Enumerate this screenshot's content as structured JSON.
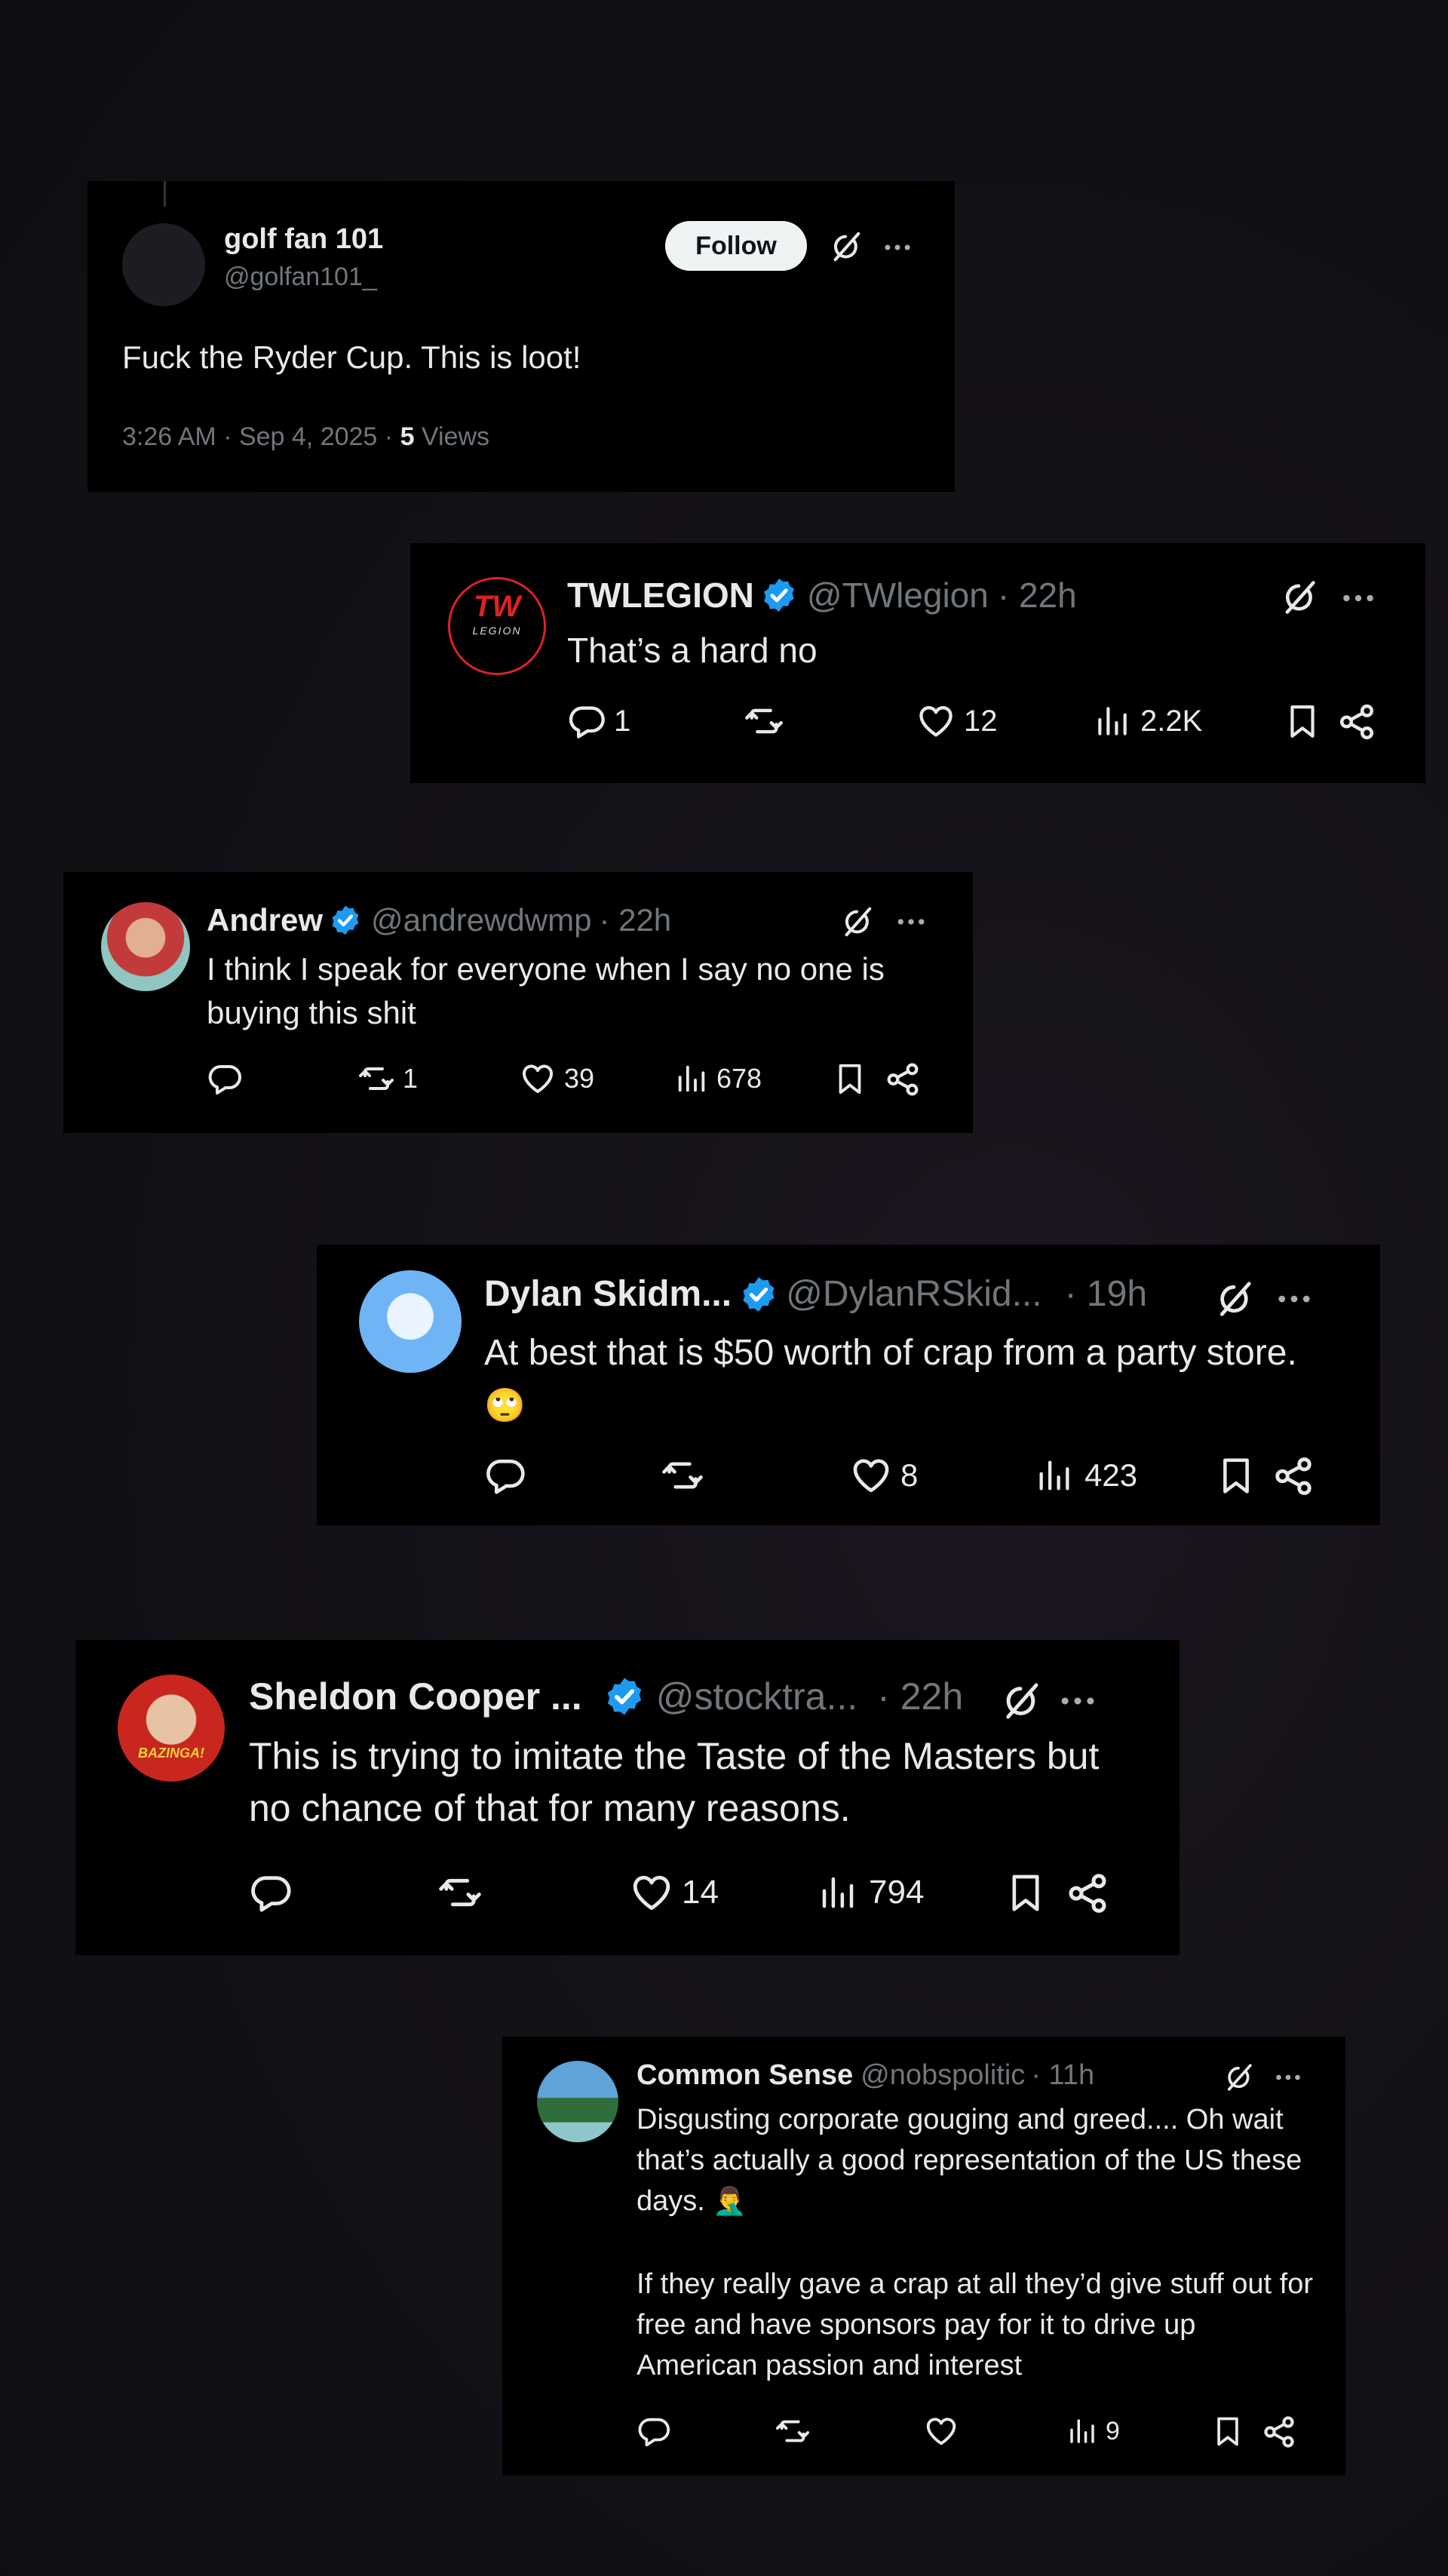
{
  "main_post": {
    "name": "golf fan 101",
    "handle": "@golfan101_",
    "follow_label": "Follow",
    "text": "Fuck the Ryder Cup. This is loot!",
    "timestamp": "3:26 AM · Sep 4, 2025 · ",
    "views_count": "5",
    "views_label": " Views"
  },
  "replies": [
    {
      "name": "TWLEGION",
      "handle": "@TWlegion",
      "time": "· 22h",
      "text": "That’s a hard no",
      "replies": "1",
      "reposts": "",
      "likes": "12",
      "views": "2.2K",
      "avatar_text": "TW",
      "avatar_sub": "LEGION"
    },
    {
      "name": "Andrew",
      "handle": "@andrewdwmp",
      "time": "· 22h",
      "text": "I think I speak for everyone when I say no one is buying this shit",
      "replies": "",
      "reposts": "1",
      "likes": "39",
      "views": "678"
    },
    {
      "name": "Dylan Skidm...",
      "handle": "@DylanRSkid...",
      "time": "· 19h",
      "text": "At best that is $50 worth of crap from a party store.",
      "emoji": "🙄",
      "replies": "",
      "reposts": "",
      "likes": "8",
      "views": "423"
    },
    {
      "name": "Sheldon Cooper ...",
      "handle": "@stocktra...",
      "time": "· 22h",
      "text": "This is trying to imitate the Taste of the Masters but no chance of that for many reasons.",
      "replies": "",
      "reposts": "",
      "likes": "14",
      "views": "794",
      "avatar_text": "BAZINGA!"
    },
    {
      "name": "Common Sense",
      "handle": "@nobspolitic",
      "time": "· 11h",
      "text": "Disgusting corporate gouging and greed.... Oh wait that’s actually a good representation of the US these days.",
      "emoji": "🤦‍♂️",
      "text2": "If they really gave a crap at all they’d give stuff out for free and have sponsors pay for it to drive up American passion and interest",
      "replies": "",
      "reposts": "",
      "likes": "",
      "views": "9"
    }
  ],
  "colors": {
    "verified_blue": "#1d9bf0",
    "muted": "#71767b",
    "text": "#e7e9ea",
    "card_bg": "#000000"
  },
  "icons": [
    "verified-icon",
    "grok-icon",
    "more-icon",
    "reply-icon",
    "repost-icon",
    "like-icon",
    "views-icon",
    "bookmark-icon",
    "share-icon"
  ]
}
